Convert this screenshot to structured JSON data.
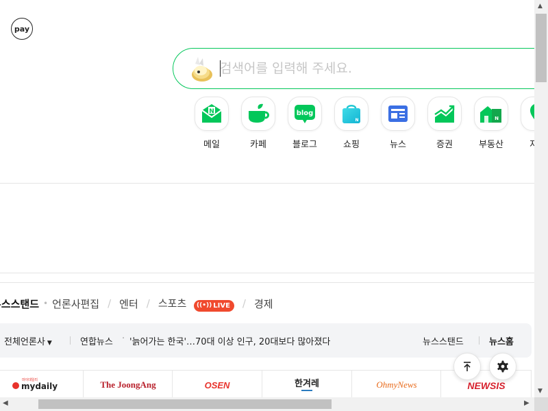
{
  "pay": {
    "label": "pay"
  },
  "search": {
    "placeholder": "검색어를 입력해 주세요."
  },
  "shortcuts": [
    {
      "label": "메일",
      "icon": "mail-icon"
    },
    {
      "label": "카페",
      "icon": "cafe-icon"
    },
    {
      "label": "블로그",
      "icon": "blog-icon",
      "icon_text": "blog"
    },
    {
      "label": "쇼핑",
      "icon": "shopping-icon"
    },
    {
      "label": "뉴스",
      "icon": "news-icon"
    },
    {
      "label": "증권",
      "icon": "stock-icon"
    },
    {
      "label": "부동산",
      "icon": "realestate-icon"
    },
    {
      "label": "지도",
      "icon": "map-icon"
    }
  ],
  "news_tabs": {
    "items": [
      "뉴스스탠드",
      "언론사편집",
      "엔터",
      "스포츠",
      "경제"
    ],
    "live_label": "LIVE"
  },
  "news_bar": {
    "press_select": "전체언론사",
    "source": "연합뉴스",
    "headline": "'늙어가는 한국'…70대 이상 인구, 20대보다 많아졌다",
    "newsstand_link": "뉴스스탠드",
    "newshome_link": "뉴스홈"
  },
  "press_logos": [
    {
      "name": "mydaily",
      "small": "마이데일리"
    },
    {
      "name": "The JoongAng"
    },
    {
      "name": "OSEN"
    },
    {
      "name": "한겨레"
    },
    {
      "name": "OhmyNews"
    },
    {
      "name": "NEWSIS"
    }
  ],
  "colors": {
    "brand_green": "#03c75a",
    "live_red": "#f04a2e"
  }
}
